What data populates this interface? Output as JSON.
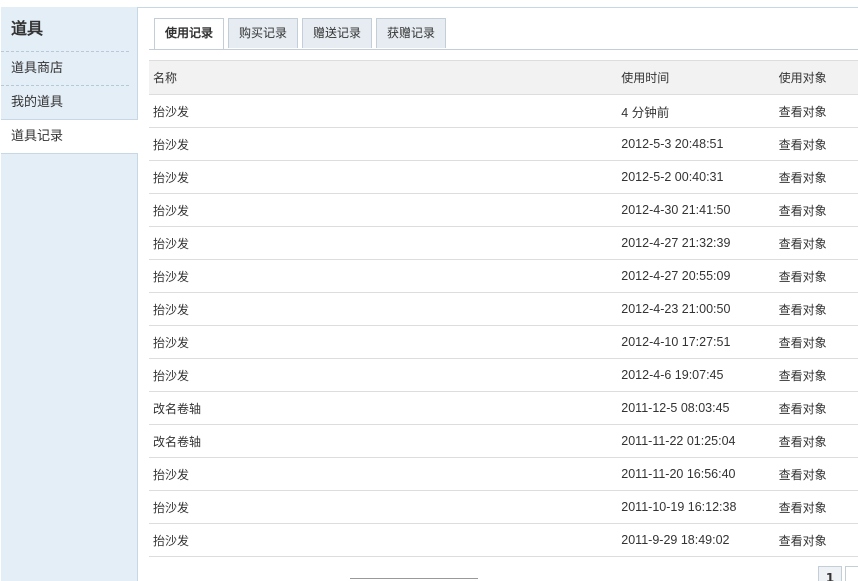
{
  "sidebar": {
    "title": "道具",
    "items": [
      {
        "label": "道具商店"
      },
      {
        "label": "我的道具"
      },
      {
        "label": "道具记录"
      }
    ]
  },
  "tabs": [
    {
      "label": "使用记录"
    },
    {
      "label": "购买记录"
    },
    {
      "label": "赠送记录"
    },
    {
      "label": "获赠记录"
    }
  ],
  "table": {
    "headers": {
      "name": "名称",
      "time": "使用时间",
      "target": "使用对象"
    },
    "rows": [
      {
        "name": "抬沙发",
        "time": "4 分钟前",
        "target": "查看对象"
      },
      {
        "name": "抬沙发",
        "time": "2012-5-3 20:48:51",
        "target": "查看对象"
      },
      {
        "name": "抬沙发",
        "time": "2012-5-2 00:40:31",
        "target": "查看对象"
      },
      {
        "name": "抬沙发",
        "time": "2012-4-30 21:41:50",
        "target": "查看对象"
      },
      {
        "name": "抬沙发",
        "time": "2012-4-27 21:32:39",
        "target": "查看对象"
      },
      {
        "name": "抬沙发",
        "time": "2012-4-27 20:55:09",
        "target": "查看对象"
      },
      {
        "name": "抬沙发",
        "time": "2012-4-23 21:00:50",
        "target": "查看对象"
      },
      {
        "name": "抬沙发",
        "time": "2012-4-10 17:27:51",
        "target": "查看对象"
      },
      {
        "name": "抬沙发",
        "time": "2012-4-6 19:07:45",
        "target": "查看对象"
      },
      {
        "name": "改名卷轴",
        "time": "2011-12-5 08:03:45",
        "target": "查看对象"
      },
      {
        "name": "改名卷轴",
        "time": "2011-11-22 01:25:04",
        "target": "查看对象"
      },
      {
        "name": "抬沙发",
        "time": "2011-11-20 16:56:40",
        "target": "查看对象"
      },
      {
        "name": "抬沙发",
        "time": "2011-10-19 16:12:38",
        "target": "查看对象"
      },
      {
        "name": "抬沙发",
        "time": "2011-9-29 18:49:02",
        "target": "查看对象"
      }
    ]
  },
  "pagination": {
    "current": "1"
  }
}
